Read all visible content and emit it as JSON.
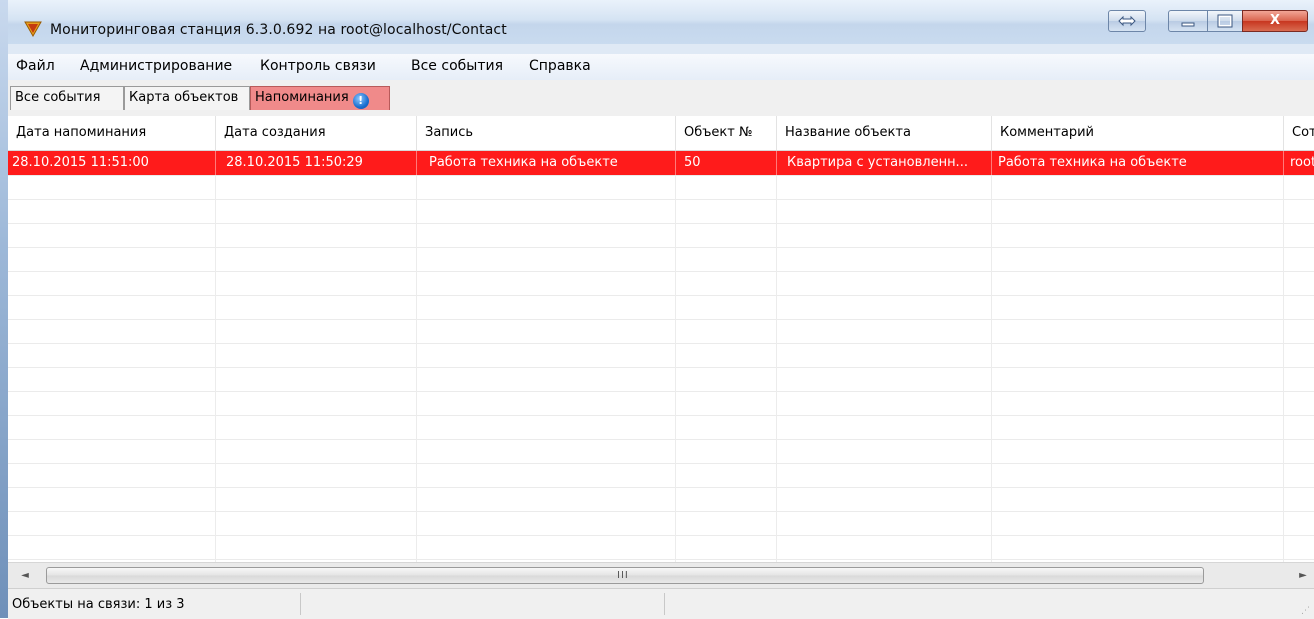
{
  "window": {
    "title": "Мониторинговая станция 6.3.0.692 на root@localhost/Contact",
    "close_glyph": "X"
  },
  "menu": [
    "Файл",
    "Администрирование",
    "Контроль связи",
    "Все события",
    "Справка"
  ],
  "tabs": [
    {
      "label": "Все события",
      "active": false
    },
    {
      "label": "Карта объектов",
      "active": false
    },
    {
      "label": "Напоминания",
      "active": true,
      "badge": "!"
    }
  ],
  "table": {
    "columns": [
      "Дата напоминания",
      "Дата создания",
      "Запись",
      "Объект №",
      "Название объекта",
      "Комментарий",
      "Сот"
    ],
    "rows": [
      [
        "28.10.2015 11:51:00",
        "28.10.2015 11:50:29",
        "Работа техника на объекте",
        "50",
        "Квартира с установленн...",
        "Работа техника на объекте",
        "root"
      ]
    ],
    "selected_color": "#ff1b1b"
  },
  "scrollbar": {
    "grip": "III",
    "left_arrow": "◄",
    "right_arrow": "►"
  },
  "status": {
    "connection": "Объекты на связи: 1 из 3"
  }
}
